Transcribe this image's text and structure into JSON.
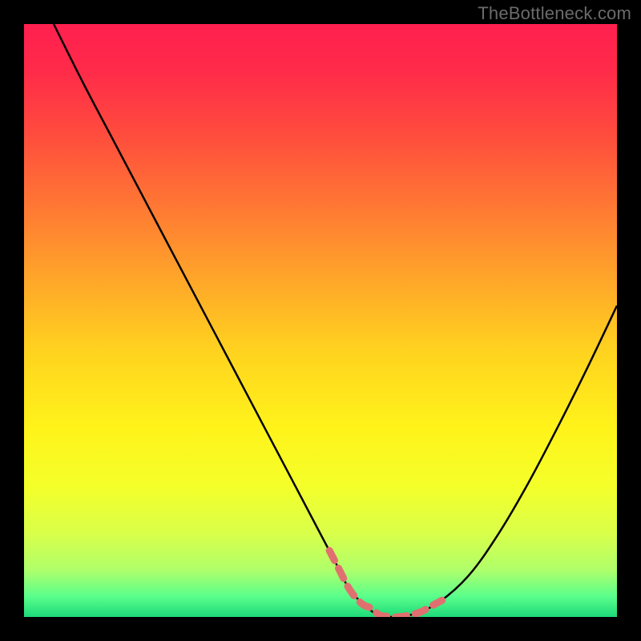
{
  "watermark": "TheBottleneck.com",
  "chart_data": {
    "type": "line",
    "title": "",
    "xlabel": "",
    "ylabel": "",
    "xlim": [
      0,
      100
    ],
    "ylim": [
      0,
      100
    ],
    "grid": false,
    "legend_position": "none",
    "series": [
      {
        "name": "curve",
        "color": "#000000",
        "x": [
          5,
          10,
          15,
          20,
          25,
          30,
          35,
          40,
          45,
          50,
          53,
          55,
          58,
          60,
          63,
          66,
          70,
          75,
          80,
          85,
          90,
          95,
          100
        ],
        "values": [
          100,
          90,
          80.5,
          71,
          61.5,
          52,
          42.5,
          33,
          23.5,
          14,
          8.3,
          4.5,
          1.5,
          0.3,
          0,
          0.6,
          2.5,
          7,
          14,
          22.5,
          32,
          42,
          52.5
        ]
      },
      {
        "name": "highlight",
        "color": "#e07070",
        "x": [
          51.5,
          53,
          55,
          57,
          58.5,
          60,
          61.5,
          63,
          65,
          67,
          69,
          70.5
        ],
        "values": [
          11.2,
          8.3,
          4.5,
          2.2,
          1.5,
          0.3,
          0.1,
          0,
          0.3,
          0.9,
          2.0,
          2.8
        ]
      }
    ],
    "gradient": {
      "stops": [
        {
          "offset": 0.0,
          "color": "#ff1f4f"
        },
        {
          "offset": 0.08,
          "color": "#ff2b49"
        },
        {
          "offset": 0.18,
          "color": "#ff4a3e"
        },
        {
          "offset": 0.3,
          "color": "#ff7534"
        },
        {
          "offset": 0.42,
          "color": "#ffa22a"
        },
        {
          "offset": 0.55,
          "color": "#ffd21f"
        },
        {
          "offset": 0.68,
          "color": "#fff31a"
        },
        {
          "offset": 0.78,
          "color": "#f4ff2a"
        },
        {
          "offset": 0.86,
          "color": "#d9ff4a"
        },
        {
          "offset": 0.92,
          "color": "#b0ff6a"
        },
        {
          "offset": 0.965,
          "color": "#5bff8c"
        },
        {
          "offset": 1.0,
          "color": "#1dd979"
        }
      ]
    }
  }
}
